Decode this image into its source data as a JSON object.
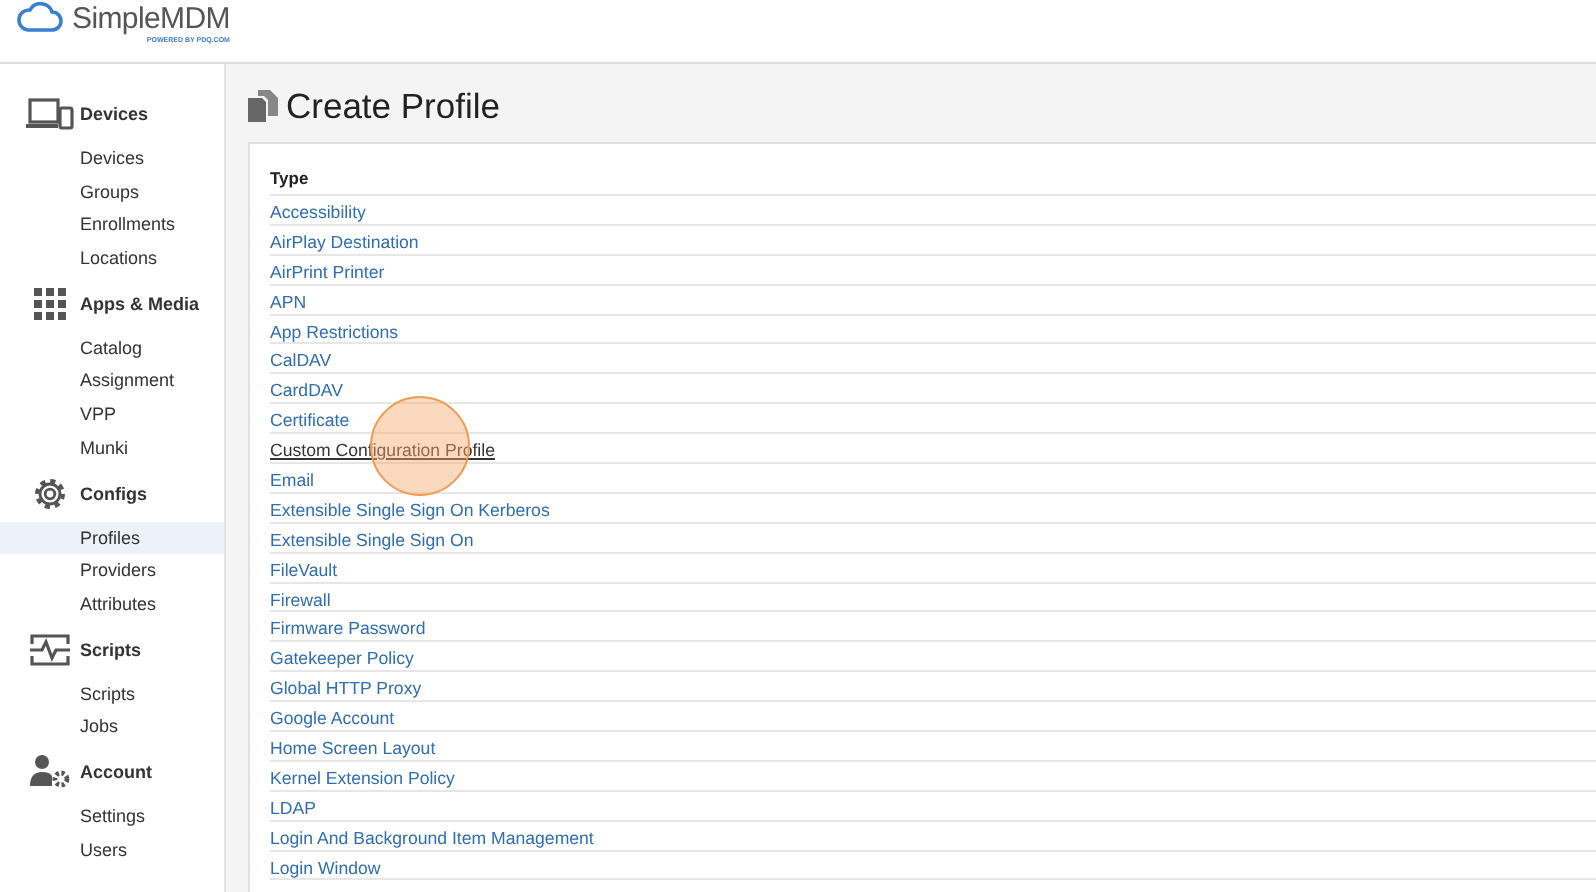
{
  "brand": {
    "name": "SimpleMDM",
    "tagline": "POWERED BY PDQ.COM"
  },
  "sidebar": {
    "sections": [
      {
        "kind": "devices",
        "title": "Devices",
        "items": [
          {
            "label": "Devices",
            "selected": false
          },
          {
            "label": "Groups",
            "selected": false
          },
          {
            "label": "Enrollments",
            "selected": false
          },
          {
            "label": "Locations",
            "selected": false
          }
        ]
      },
      {
        "kind": "apps",
        "title": "Apps & Media",
        "items": [
          {
            "label": "Catalog",
            "selected": false
          },
          {
            "label": "Assignment",
            "selected": false
          },
          {
            "label": "VPP",
            "selected": false
          },
          {
            "label": "Munki",
            "selected": false
          }
        ]
      },
      {
        "kind": "configs",
        "title": "Configs",
        "items": [
          {
            "label": "Profiles",
            "selected": true
          },
          {
            "label": "Providers",
            "selected": false
          },
          {
            "label": "Attributes",
            "selected": false
          }
        ]
      },
      {
        "kind": "scripts",
        "title": "Scripts",
        "items": [
          {
            "label": "Scripts",
            "selected": false
          },
          {
            "label": "Jobs",
            "selected": false
          }
        ]
      },
      {
        "kind": "account",
        "title": "Account",
        "items": [
          {
            "label": "Settings",
            "selected": false
          },
          {
            "label": "Users",
            "selected": false
          }
        ]
      }
    ]
  },
  "page": {
    "title": "Create Profile"
  },
  "table": {
    "columns": [
      "Type"
    ],
    "rows": [
      {
        "label": "Accessibility",
        "hovered": false
      },
      {
        "label": "AirPlay Destination",
        "hovered": false
      },
      {
        "label": "AirPrint Printer",
        "hovered": false
      },
      {
        "label": "APN",
        "hovered": false
      },
      {
        "label": "App Restrictions",
        "hovered": false
      },
      {
        "label": "CalDAV",
        "hovered": false
      },
      {
        "label": "CardDAV",
        "hovered": false
      },
      {
        "label": "Certificate",
        "hovered": false
      },
      {
        "label": "Custom Configuration Profile",
        "hovered": true
      },
      {
        "label": "Email",
        "hovered": false
      },
      {
        "label": "Extensible Single Sign On Kerberos",
        "hovered": false
      },
      {
        "label": "Extensible Single Sign On",
        "hovered": false
      },
      {
        "label": "FileVault",
        "hovered": false
      },
      {
        "label": "Firewall",
        "hovered": false
      },
      {
        "label": "Firmware Password",
        "hovered": false
      },
      {
        "label": "Gatekeeper Policy",
        "hovered": false
      },
      {
        "label": "Global HTTP Proxy",
        "hovered": false
      },
      {
        "label": "Google Account",
        "hovered": false
      },
      {
        "label": "Home Screen Layout",
        "hovered": false
      },
      {
        "label": "Kernel Extension Policy",
        "hovered": false
      },
      {
        "label": "LDAP",
        "hovered": false
      },
      {
        "label": "Login And Background Item Management",
        "hovered": false
      },
      {
        "label": "Login Window",
        "hovered": false
      }
    ]
  }
}
